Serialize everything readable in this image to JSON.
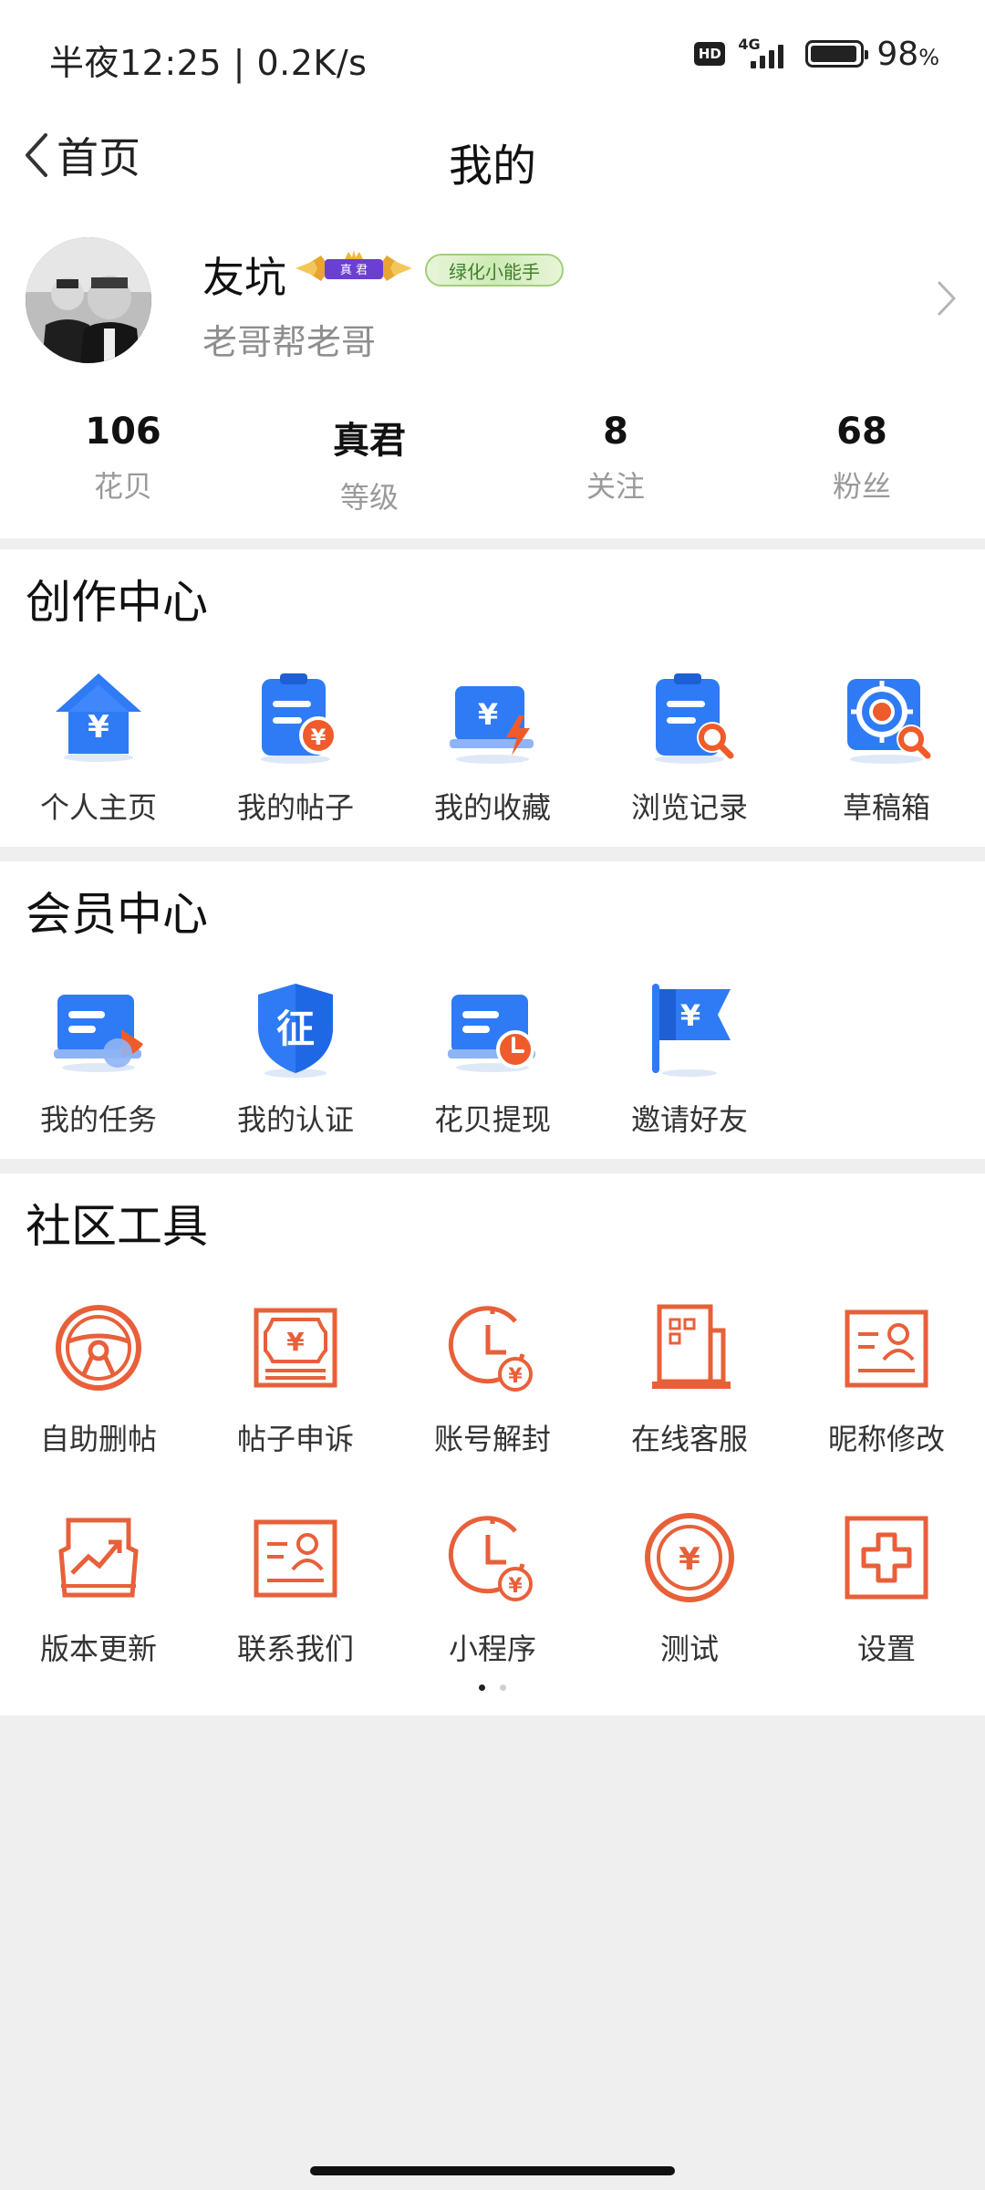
{
  "status_bar": {
    "time": "半夜12:25 | 0.2K/s",
    "hd": "HD",
    "network": "4G",
    "battery": "98",
    "battery_unit": "%"
  },
  "nav": {
    "back_label": "首页",
    "title": "我的"
  },
  "profile": {
    "name": "友坑",
    "rank_badge": "真 君",
    "title_badge": "绿化小能手",
    "signature": "老哥帮老哥"
  },
  "stats": [
    {
      "value": "106",
      "label": "花贝"
    },
    {
      "value": "真君",
      "label": "等级"
    },
    {
      "value": "8",
      "label": "关注"
    },
    {
      "value": "68",
      "label": "粉丝"
    }
  ],
  "creation_center": {
    "title": "创作中心",
    "items": [
      {
        "label": "个人主页",
        "icon": "home-yuan-icon"
      },
      {
        "label": "我的帖子",
        "icon": "post-clipboard-icon"
      },
      {
        "label": "我的收藏",
        "icon": "collection-laptop-icon"
      },
      {
        "label": "浏览记录",
        "icon": "history-search-icon"
      },
      {
        "label": "草稿箱",
        "icon": "drafts-target-icon"
      }
    ]
  },
  "member_center": {
    "title": "会员中心",
    "items": [
      {
        "label": "我的任务",
        "icon": "tasks-icon"
      },
      {
        "label": "我的认证",
        "icon": "verification-shield-icon",
        "glyph": "征"
      },
      {
        "label": "花贝提现",
        "icon": "withdraw-icon"
      },
      {
        "label": "邀请好友",
        "icon": "invite-flag-icon"
      }
    ]
  },
  "community_tools": {
    "title": "社区工具",
    "rows": [
      [
        {
          "label": "自助删帖",
          "icon": "steering-wheel-icon"
        },
        {
          "label": "帖子申诉",
          "icon": "appeal-note-icon"
        },
        {
          "label": "账号解封",
          "icon": "clock-unban-icon"
        },
        {
          "label": "在线客服",
          "icon": "online-service-icon"
        },
        {
          "label": "昵称修改",
          "icon": "id-card-icon"
        }
      ],
      [
        {
          "label": "版本更新",
          "icon": "trend-chart-icon"
        },
        {
          "label": "联系我们",
          "icon": "contact-card-icon"
        },
        {
          "label": "小程序",
          "icon": "mini-program-clock-icon"
        },
        {
          "label": "测试",
          "icon": "coin-icon"
        },
        {
          "label": "设置",
          "icon": "plus-box-icon"
        }
      ]
    ],
    "pager": {
      "pages": 2,
      "current": 1
    }
  },
  "colors": {
    "blue": "#2f7bf5",
    "orange": "#e8603a",
    "divider": "#efeff0"
  }
}
